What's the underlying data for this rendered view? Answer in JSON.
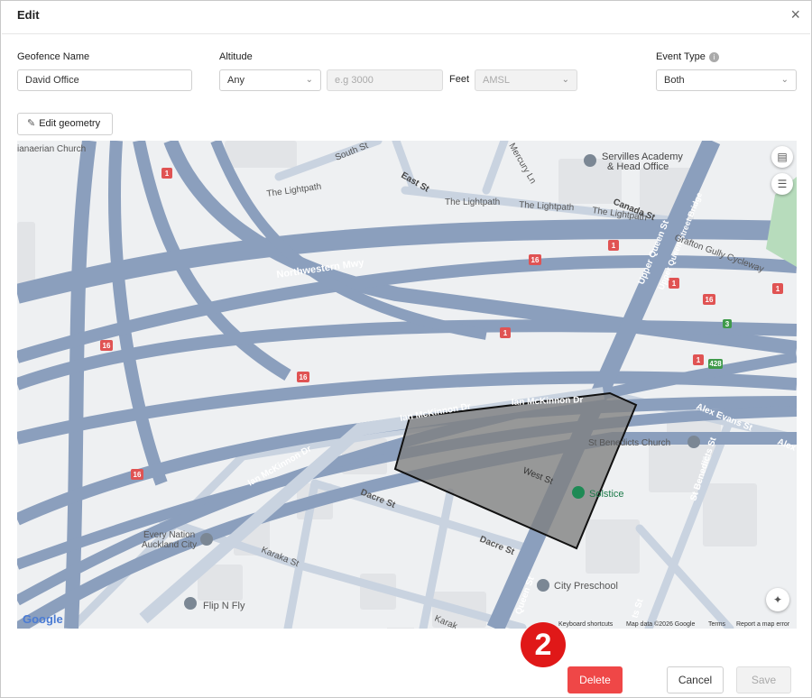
{
  "dialog": {
    "title": "Edit",
    "close_glyph": "×"
  },
  "form": {
    "geofence_name_label": "Geofence Name",
    "geofence_name_value": "David Office",
    "altitude_label": "Altitude",
    "altitude_select": "Any",
    "altitude_placeholder": "e.g 3000",
    "feet_label": "Feet",
    "reference_select": "AMSL",
    "event_type_label": "Event Type",
    "event_type_select": "Both"
  },
  "edit_geometry_label": "Edit geometry",
  "map": {
    "labels": {
      "church_fragment": "ianaerian Church",
      "south_st": "South St",
      "mercury_ln": "Mercury Ln",
      "servilles": "Servilles Academy",
      "servilles2": "& Head Office",
      "east_st": "East St",
      "lightpath1": "The Lightpath",
      "lightpath2": "The Lightpath",
      "lightpath3": "The Lightpath",
      "lightpath4": "The Lightpath",
      "canada_st": "Canada St",
      "upper_queen_st": "Upper Queen St",
      "upper_queen_bridge": "Upper Queen Street Bridge",
      "grafton_gully": "Grafton Gully Cycleway",
      "northwestern_mwy": "Northwestern Mwy",
      "ian_mckinnon_1": "Ian McKinnon Dr",
      "ian_mckinnon_2": "Ian McKinnon Dr",
      "ian_mckinnon_3": "Ian McKinnon Dr",
      "alex_evans": "Alex Evans St",
      "alex_frag": "Alex",
      "st_benedicts_church": "St Benedicts Church",
      "st_benedicts_st": "St Benedicts St",
      "west_st": "West St",
      "solstice": "Solstice",
      "dacre_st_1": "Dacre St",
      "dacre_st_2": "Dacre St",
      "every_nation": "Every Nation",
      "auckland_city": "Auckland City",
      "karaka_st": "Karaka St",
      "city_preschool": "City Preschool",
      "flip_n_fly": "Flip N Fly",
      "lower_queen_st": "Queen St",
      "karaka_frag": "Karak",
      "ts_frag": "ts St"
    },
    "shields": {
      "r1": "1",
      "r16": "16",
      "r3": "3",
      "r428": "428"
    },
    "google_logo": "Google",
    "attribution": {
      "keyboard": "Keyboard shortcuts",
      "data": "Map data ©2026 Google",
      "terms": "Terms",
      "report": "Report a map error"
    },
    "icons": [
      "map-type-icon",
      "layers-icon",
      "recenter-icon"
    ]
  },
  "step_badge": "2",
  "footer": {
    "delete": "Delete",
    "cancel": "Cancel",
    "save": "Save"
  },
  "colors": {
    "delete": "#ef4747",
    "badge": "#e01818",
    "motorway": "#8b9fbd",
    "geofence_fill": "#7f7f7f"
  }
}
